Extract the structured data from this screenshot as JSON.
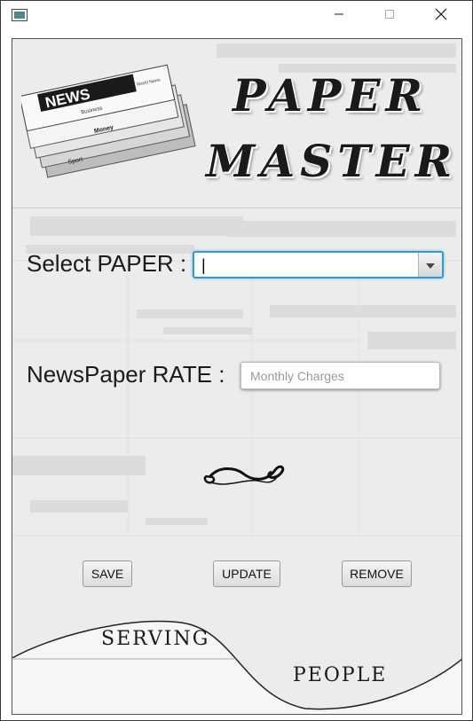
{
  "window": {
    "title": "",
    "controls": {
      "minimize": "minimize-icon",
      "maximize": "maximize-icon",
      "close": "close-icon"
    }
  },
  "header": {
    "newspaper_word": "NEWS",
    "newspaper_sub": [
      "World News",
      "Business",
      "Money",
      "Sport"
    ],
    "title_line1": "PAPER",
    "title_line2": "MASTER"
  },
  "form": {
    "paper_label": "Select PAPER :",
    "paper_value": "|",
    "rate_label": "NewsPaper RATE :",
    "rate_value": "",
    "rate_placeholder": "Monthly Charges"
  },
  "buttons": {
    "save": "SAVE",
    "update": "UPDATE",
    "remove": "REMOVE"
  },
  "footer": {
    "slogan_left": "SERVING",
    "slogan_right": "PEOPLE"
  },
  "colors": {
    "focus_accent": "#2f9ad6",
    "panel_bg": "#ececec"
  }
}
